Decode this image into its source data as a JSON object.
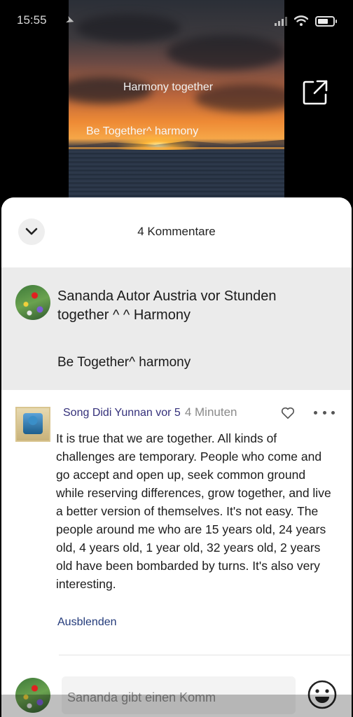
{
  "status_bar": {
    "time": "15:55",
    "icons": [
      "location-arrow-icon",
      "signal-icon",
      "wifi-icon",
      "battery-icon"
    ]
  },
  "video": {
    "overlay_text_1": "Harmony together",
    "overlay_text_2": "Be Together^ harmony",
    "share_icon": "share-external-icon"
  },
  "comments_sheet": {
    "title": "4 Kommentare",
    "collapse_icon": "chevron-down-icon",
    "post": {
      "header_text": "Sananda Autor Austria vor Stunden together ^ ^ Harmony",
      "body": "Be Together^ harmony"
    },
    "comment": {
      "author": "Song Didi Yunnan vor 5",
      "time": "4 Minuten",
      "text": "It is true that we are together. All kinds of challenges are temporary. People who come and go accept and open up, seek common ground while reserving differences, grow together, and live a better version of themselves. It's not easy. The people around me who are 15 years old, 24 years old, 4 years old, 1 year old, 32 years old, 2 years old have been bombarded by turns. It's also very interesting.",
      "hide_label": "Ausblenden",
      "like_icon": "heart-outline-icon",
      "more_icon": "more-dots-icon"
    },
    "input": {
      "placeholder": "Sananda gibt einen Komm",
      "emoji_icon": "emoji-smile-icon"
    }
  },
  "colors": {
    "author_link": "#34307a",
    "hide_link": "#233a7a",
    "post_bg": "#ebebeb"
  }
}
